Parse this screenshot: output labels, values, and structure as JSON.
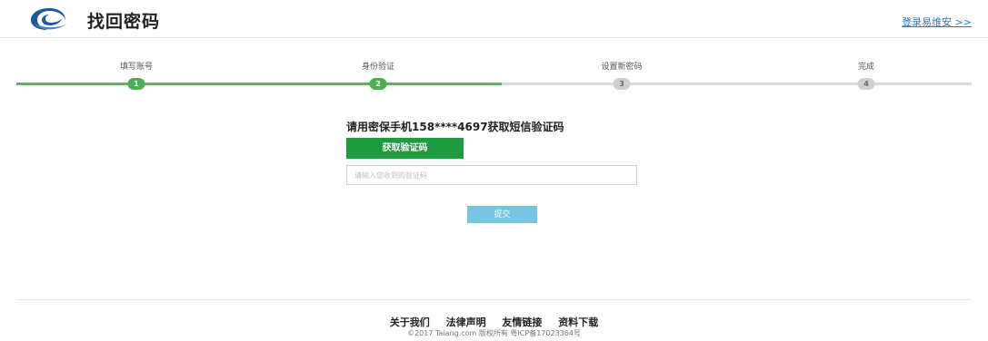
{
  "header": {
    "logo_icon": "swirl-logo-icon",
    "brand_color": "#1b5aa0",
    "title": "找回密码",
    "login_link": "登录易维安 >>"
  },
  "steps": {
    "current": 2,
    "total": 4,
    "active_color": "#4caf50",
    "inactive_color": "#cfcfcf",
    "items": [
      {
        "label": "填写账号",
        "number": "1"
      },
      {
        "label": "身份验证",
        "number": "2"
      },
      {
        "label": "设置新密码",
        "number": "3"
      },
      {
        "label": "完成",
        "number": "4"
      }
    ]
  },
  "form": {
    "prompt": "请用密保手机158****4697获取短信验证码",
    "get_code_button": "获取验证码",
    "code_placeholder": "请输入您收到的验证码",
    "submit_button": "提交"
  },
  "footer": {
    "links": [
      "关于我们",
      "法律声明",
      "友情链接",
      "资料下载"
    ],
    "copyright": "©2017 Taiang.com 版权所有 粤ICP备17023364号"
  }
}
